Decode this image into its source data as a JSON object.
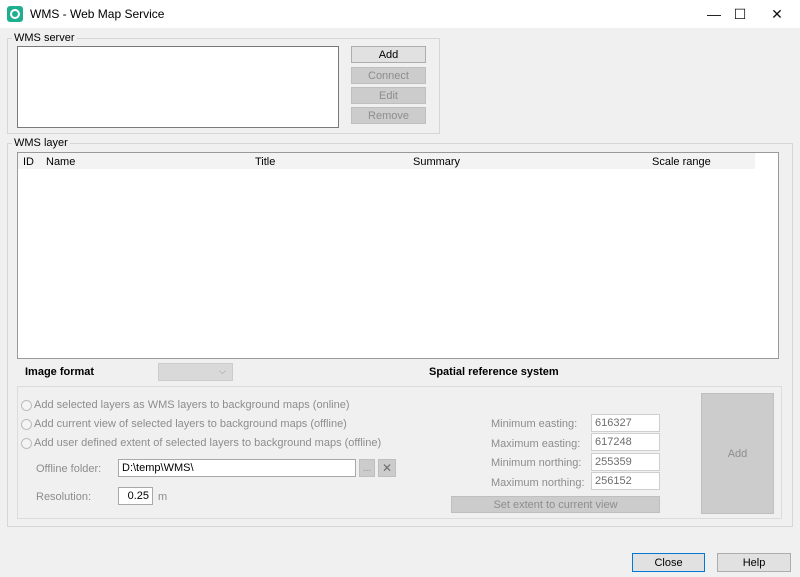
{
  "window": {
    "title": "WMS - Web Map Service",
    "minimize": "—",
    "maximize": "☐",
    "close": "✕"
  },
  "wms_server": {
    "group_label": "WMS server",
    "add_label": "Add",
    "connect_label": "Connect",
    "edit_label": "Edit",
    "remove_label": "Remove"
  },
  "wms_layer": {
    "group_label": "WMS layer",
    "columns": {
      "id": "ID",
      "name": "Name",
      "title": "Title",
      "summary": "Summary",
      "scale_range": "Scale range"
    }
  },
  "image_format": {
    "label": "Image format",
    "value": ""
  },
  "spatial_reference": {
    "label": "Spatial reference system"
  },
  "options": {
    "radio_online": "Add selected layers as WMS layers to background maps (online)",
    "radio_offline_view": "Add current view of selected layers to background maps (offline)",
    "radio_offline_extent": "Add user defined extent of selected layers to background maps (offline)",
    "offline_folder_label": "Offline folder:",
    "offline_folder_value": "D:\\temp\\WMS\\",
    "browse_label": "...",
    "resolution_label": "Resolution:",
    "resolution_value": "0.25",
    "resolution_unit": "m"
  },
  "extent": {
    "min_easting_label": "Minimum easting:",
    "min_easting": "616327",
    "max_easting_label": "Maximum easting:",
    "max_easting": "617248",
    "min_northing_label": "Minimum northing:",
    "min_northing": "255359",
    "max_northing_label": "Maximum northing:",
    "max_northing": "256152",
    "set_extent_label": "Set extent to current view",
    "add_label": "Add"
  },
  "footer": {
    "close_label": "Close",
    "help_label": "Help"
  }
}
